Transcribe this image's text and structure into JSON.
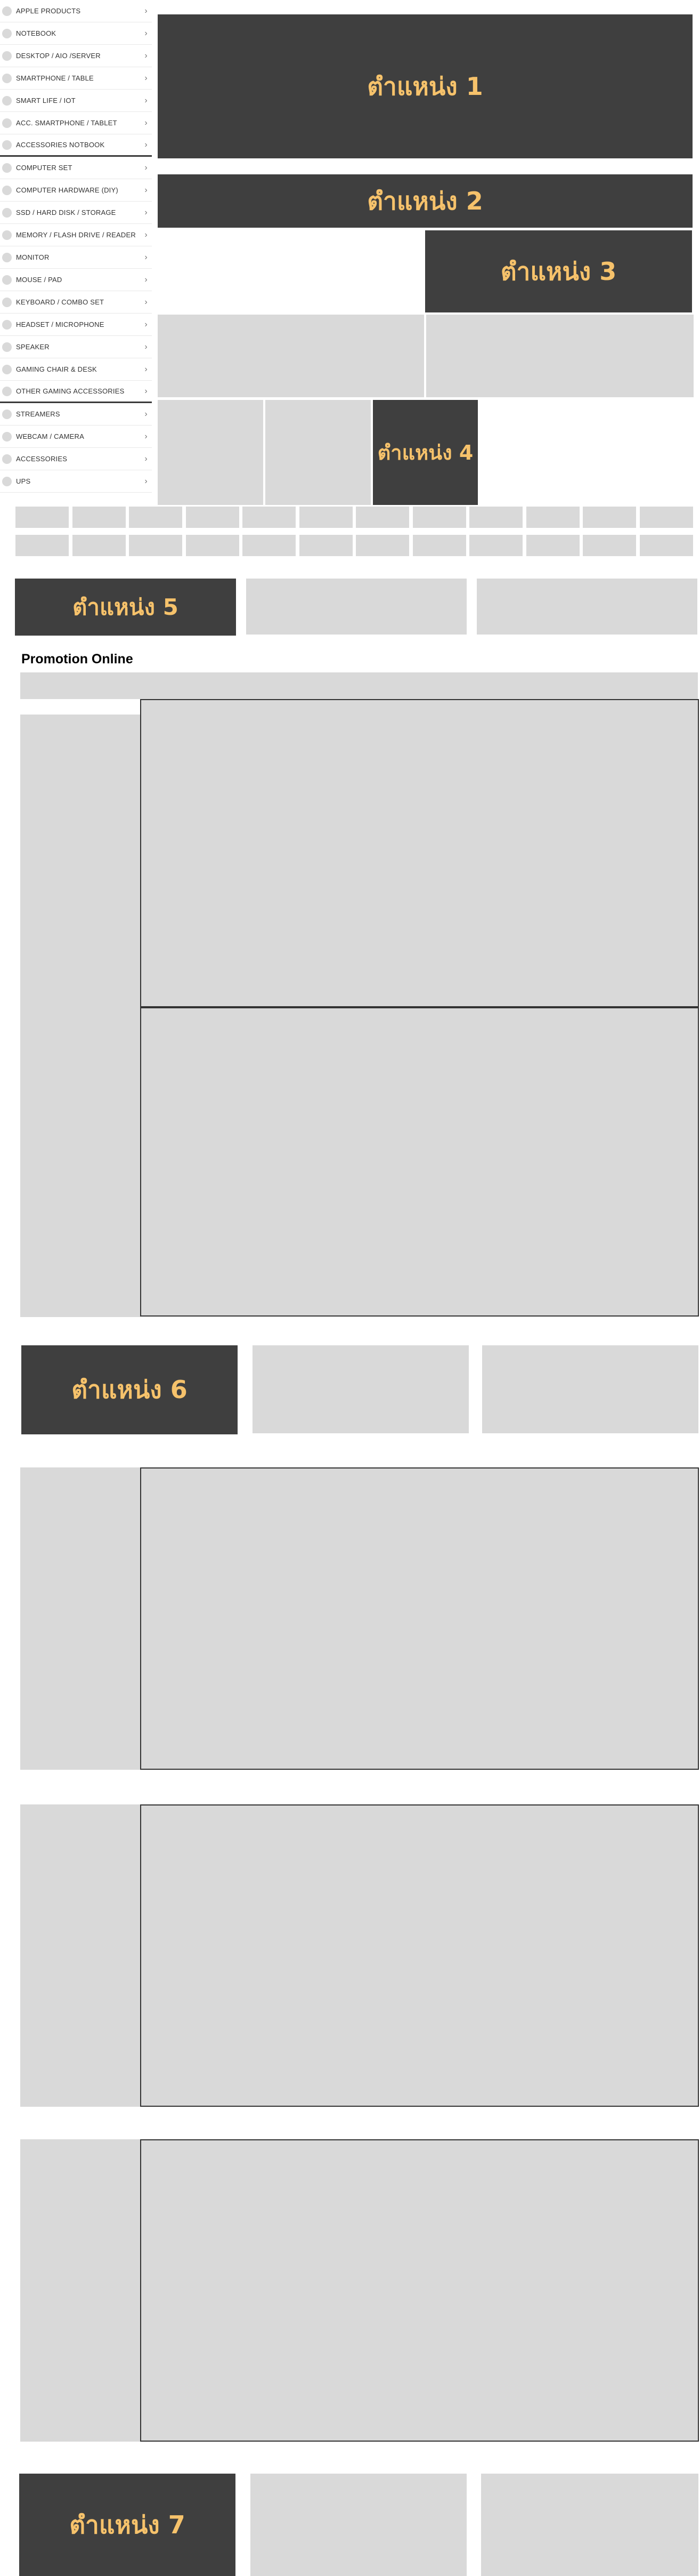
{
  "sidebar": {
    "items": [
      {
        "label": "APPLE PRODUCTS"
      },
      {
        "label": "NOTEBOOK"
      },
      {
        "label": "DESKTOP / AIO /SERVER"
      },
      {
        "label": "SMARTPHONE / TABLE"
      },
      {
        "label": "SMART LIFE / IOT"
      },
      {
        "label": "ACC. SMARTPHONE / TABLET"
      },
      {
        "label": "ACCESSORIES NOTBOOK"
      },
      {
        "label": "COMPUTER SET"
      },
      {
        "label": "COMPUTER HARDWARE (DIY)"
      },
      {
        "label": "SSD / HARD DISK / STORAGE"
      },
      {
        "label": "MEMORY / FLASH DRIVE / READER"
      },
      {
        "label": "MONITOR"
      },
      {
        "label": "MOUSE / PAD"
      },
      {
        "label": "KEYBOARD / COMBO SET"
      },
      {
        "label": "HEADSET / MICROPHONE"
      },
      {
        "label": "SPEAKER"
      },
      {
        "label": "GAMING CHAIR & DESK"
      },
      {
        "label": "OTHER GAMING ACCESSORIES"
      },
      {
        "label": "STREAMERS"
      },
      {
        "label": "WEBCAM / CAMERA"
      },
      {
        "label": "ACCESSORIES"
      },
      {
        "label": "UPS"
      }
    ],
    "chevron": "›"
  },
  "banners": {
    "pos1": "ตำแหน่ง 1",
    "pos2": "ตำแหน่ง 2",
    "pos3": "ตำแหน่ง 3",
    "pos4": "ตำแหน่ง 4",
    "pos5": "ตำแหน่ง 5",
    "pos6": "ตำแหน่ง 6",
    "pos7": "ตำแหน่ง 7"
  },
  "promotion": {
    "title": "Promotion Online"
  },
  "colors": {
    "banner_bg": "#3f3f3f",
    "banner_text": "#f6c26b",
    "placeholder": "#d9d9d9"
  }
}
